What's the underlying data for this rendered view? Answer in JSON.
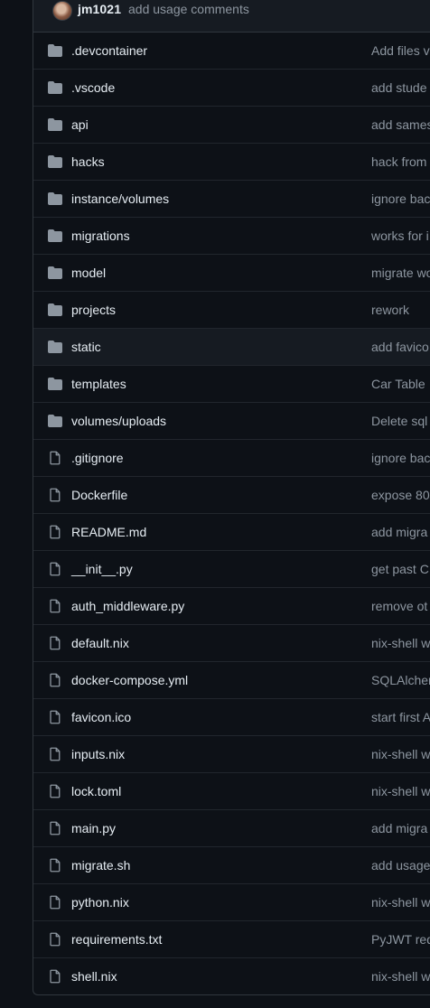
{
  "header": {
    "author": "jm1021",
    "commit_message": "add usage comments"
  },
  "colors": {
    "background": "#0d1117",
    "header_bg": "#161b22",
    "border": "#30363d",
    "row_divider": "#21262d",
    "text_primary": "#e6edf3",
    "text_muted": "#8d96a0",
    "icon": "#8d96a0"
  },
  "files": [
    {
      "name": ".devcontainer",
      "type": "folder",
      "message": "Add files v"
    },
    {
      "name": ".vscode",
      "type": "folder",
      "message": "add stude"
    },
    {
      "name": "api",
      "type": "folder",
      "message": "add sames"
    },
    {
      "name": "hacks",
      "type": "folder",
      "message": "hack from"
    },
    {
      "name": "instance/volumes",
      "type": "folder",
      "message": "ignore bac"
    },
    {
      "name": "migrations",
      "type": "folder",
      "message": "works for i"
    },
    {
      "name": "model",
      "type": "folder",
      "message": "migrate wo"
    },
    {
      "name": "projects",
      "type": "folder",
      "message": "rework"
    },
    {
      "name": "static",
      "type": "folder",
      "message": "add favico",
      "hover": true
    },
    {
      "name": "templates",
      "type": "folder",
      "message": "Car Table"
    },
    {
      "name": "volumes/uploads",
      "type": "folder",
      "message": "Delete sql"
    },
    {
      "name": ".gitignore",
      "type": "file",
      "message": "ignore bac"
    },
    {
      "name": "Dockerfile",
      "type": "file",
      "message": "expose 80"
    },
    {
      "name": "README.md",
      "type": "file",
      "message": "add migra"
    },
    {
      "name": "__init__.py",
      "type": "file",
      "message": "get past C"
    },
    {
      "name": "auth_middleware.py",
      "type": "file",
      "message": "remove ot"
    },
    {
      "name": "default.nix",
      "type": "file",
      "message": "nix-shell w"
    },
    {
      "name": "docker-compose.yml",
      "type": "file",
      "message": "SQLAlcher"
    },
    {
      "name": "favicon.ico",
      "type": "file",
      "message": "start first A"
    },
    {
      "name": "inputs.nix",
      "type": "file",
      "message": "nix-shell w"
    },
    {
      "name": "lock.toml",
      "type": "file",
      "message": "nix-shell w"
    },
    {
      "name": "main.py",
      "type": "file",
      "message": "add migra"
    },
    {
      "name": "migrate.sh",
      "type": "file",
      "message": "add usage"
    },
    {
      "name": "python.nix",
      "type": "file",
      "message": "nix-shell w"
    },
    {
      "name": "requirements.txt",
      "type": "file",
      "message": "PyJWT req"
    },
    {
      "name": "shell.nix",
      "type": "file",
      "message": "nix-shell w"
    }
  ]
}
